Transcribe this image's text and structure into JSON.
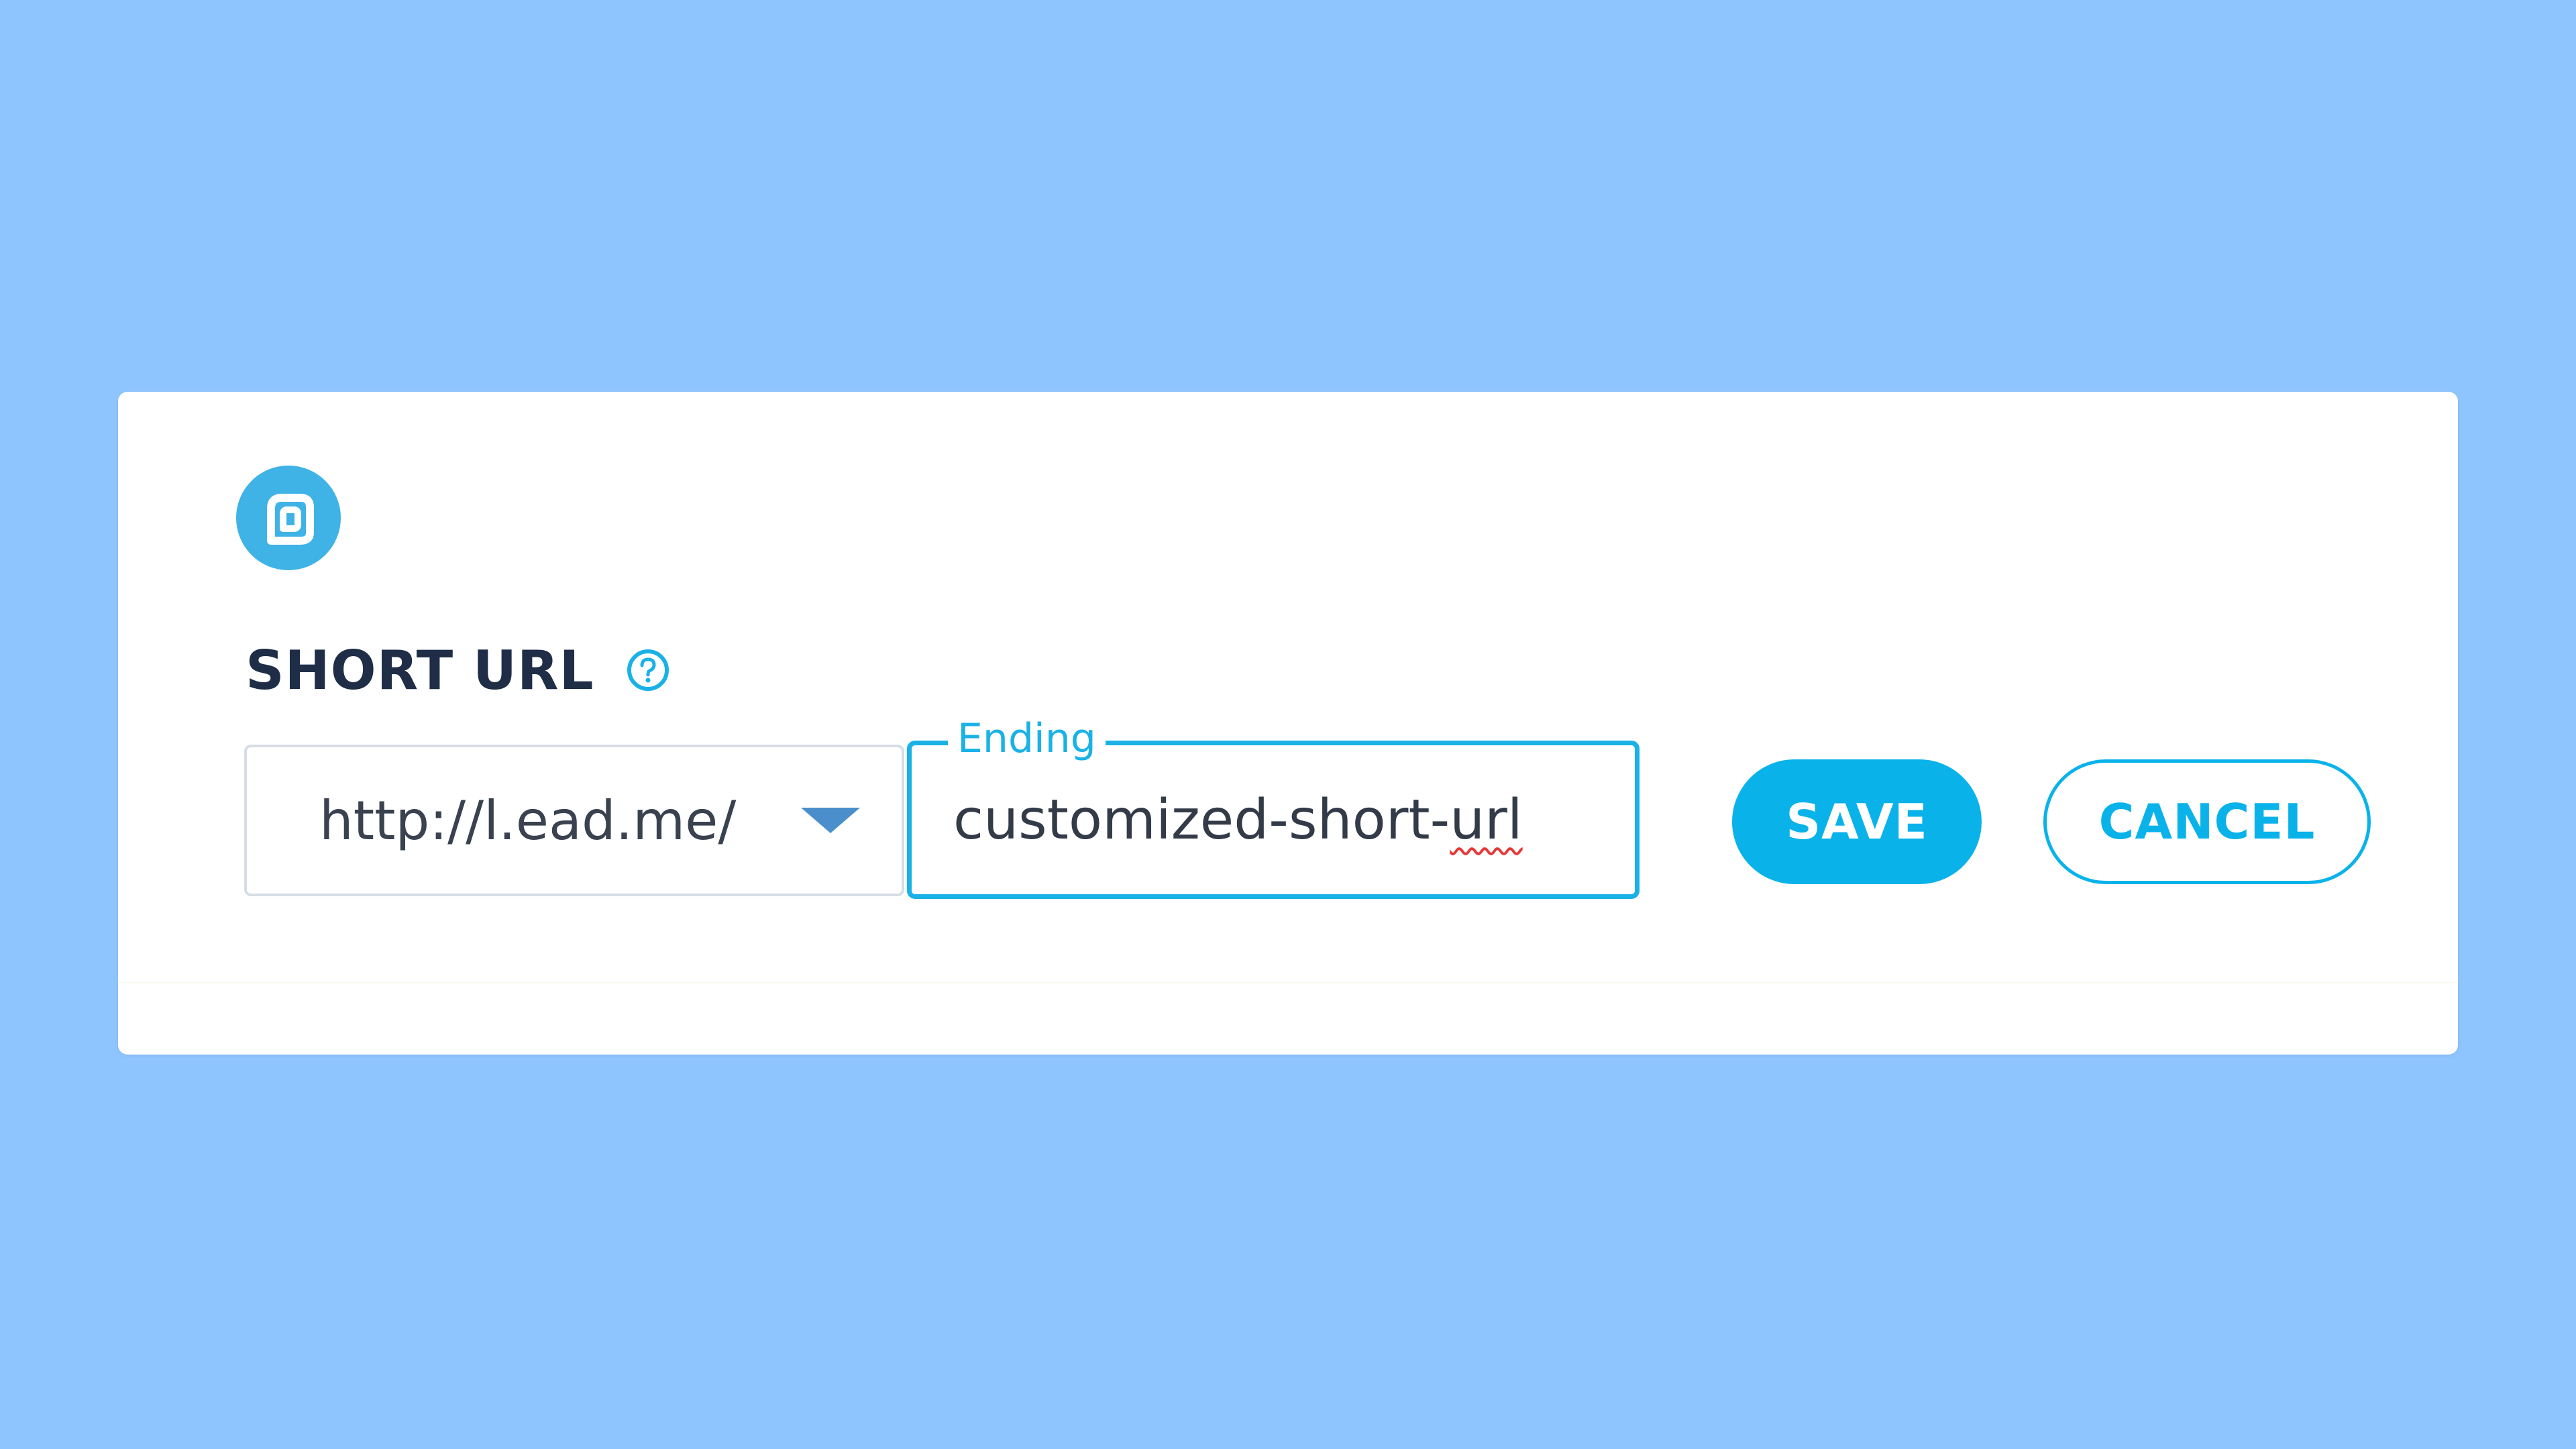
{
  "brand": {
    "logo_icon": "lead-logo-icon",
    "accent_color": "#1ab2e6"
  },
  "section": {
    "title": "SHORT URL",
    "help_icon": "question-circle-icon"
  },
  "domain_select": {
    "value": "http://l.ead.me/",
    "icon": "caret-down-icon"
  },
  "ending_field": {
    "label": "Ending",
    "value_prefix": "customized-short-",
    "value_misspelled": "url"
  },
  "actions": {
    "save_label": "SAVE",
    "cancel_label": "CANCEL"
  }
}
